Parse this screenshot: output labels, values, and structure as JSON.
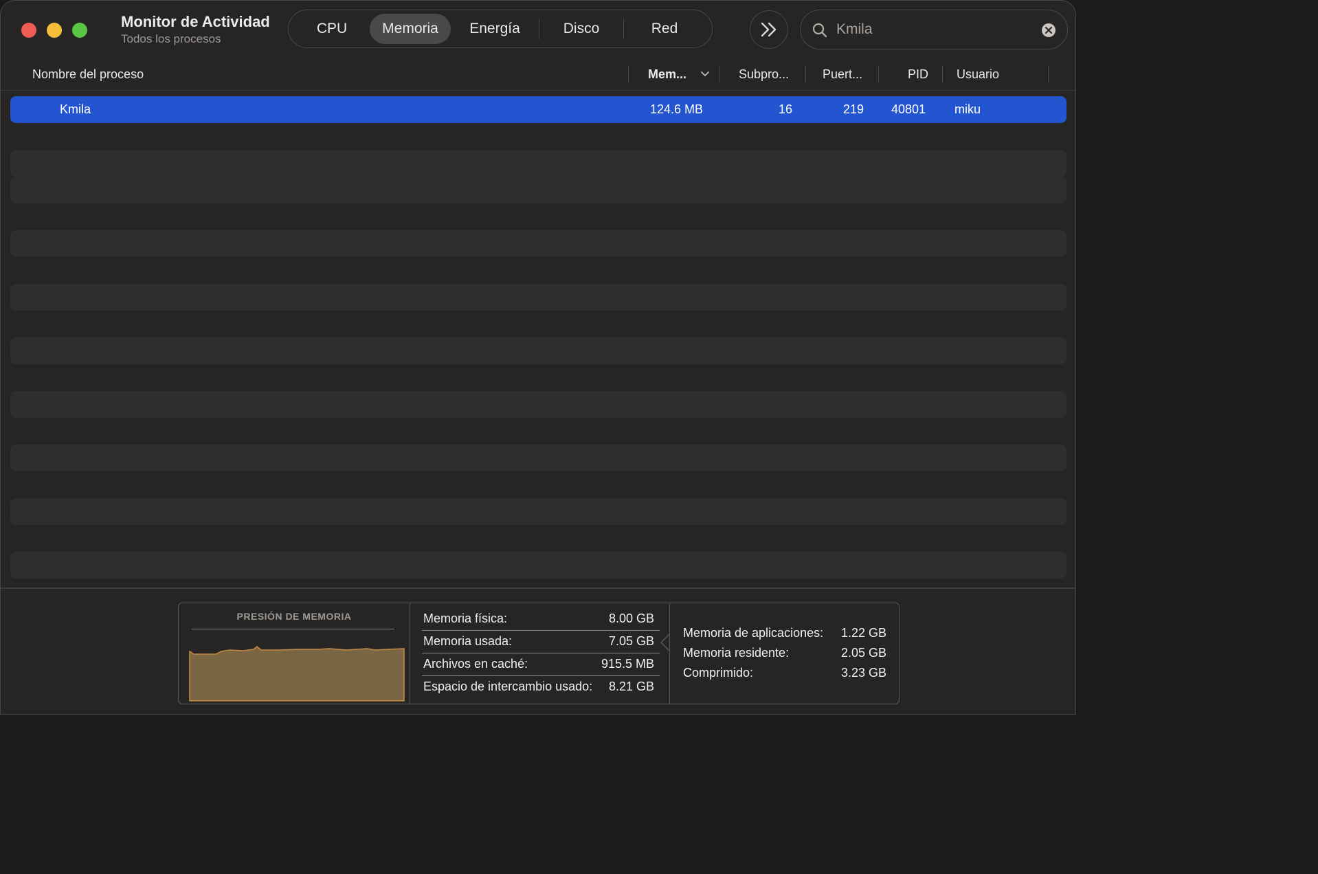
{
  "window": {
    "title": "Monitor de Actividad",
    "subtitle": "Todos los procesos"
  },
  "tabs": [
    {
      "label": "CPU",
      "active": false
    },
    {
      "label": "Memoria",
      "active": true
    },
    {
      "label": "Energía",
      "active": false
    },
    {
      "label": "Disco",
      "active": false
    },
    {
      "label": "Red",
      "active": false
    }
  ],
  "search": {
    "value": "Kmila"
  },
  "columns": {
    "name": "Nombre del proceso",
    "memory": "Mem...",
    "threads": "Subpro...",
    "ports": "Puert...",
    "pid": "PID",
    "user": "Usuario",
    "sorted_by": "Mem..."
  },
  "processes": [
    {
      "name": "Kmila",
      "memory": "124.6 MB",
      "threads": "16",
      "ports": "219",
      "pid": "40801",
      "user": "miku"
    }
  ],
  "memory_pressure": {
    "title": "PRESIÓN DE MEMORIA",
    "color": "#7a6642",
    "line_color": "#c58a45"
  },
  "memory_stats": [
    {
      "label": "Memoria física:",
      "value": "8.00 GB"
    },
    {
      "label": "Memoria usada:",
      "value": "7.05 GB"
    },
    {
      "label": "Archivos en caché:",
      "value": "915.5 MB"
    },
    {
      "label": "Espacio de intercambio usado:",
      "value": "8.21 GB"
    }
  ],
  "app_memory": [
    {
      "label": "Memoria de aplicaciones:",
      "value": "1.22 GB"
    },
    {
      "label": "Memoria residente:",
      "value": "2.05 GB"
    },
    {
      "label": "Comprimido:",
      "value": "3.23 GB"
    }
  ],
  "colors": {
    "selection": "#2355d0",
    "background": "#272524"
  }
}
